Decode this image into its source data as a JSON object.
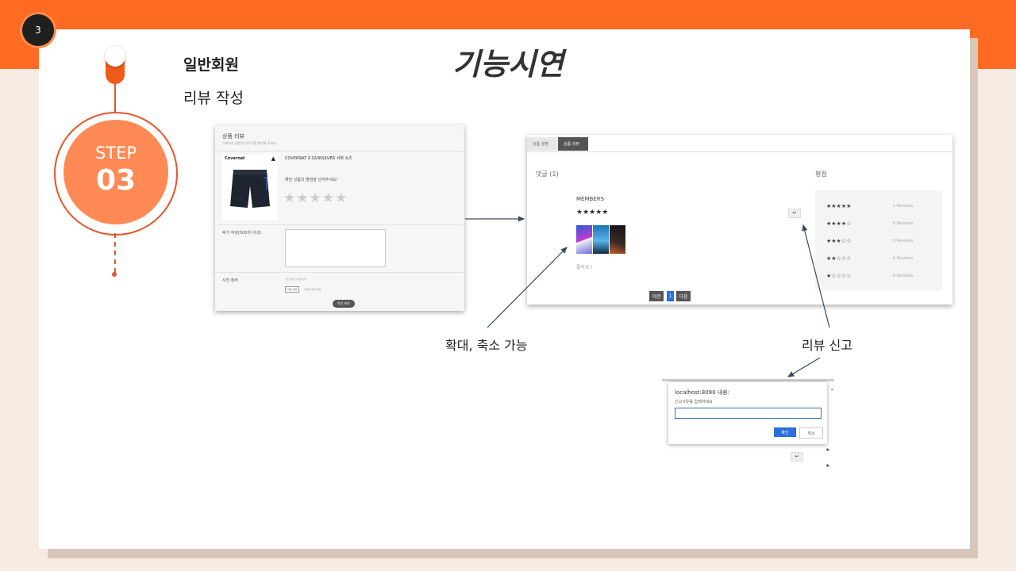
{
  "page_number": "3",
  "title": "기능시연",
  "heading": "일반회원",
  "subheading": "리뷰 작성",
  "step": {
    "label": "STEP",
    "number": "03"
  },
  "review_form": {
    "title": "상품 리뷰",
    "subtitle": "구매하신 상품의 만족도를 평가해 주세요",
    "brand_logo": "Covernat",
    "product_name": "COVERNAT X QUIKSILVER 서퍼 쇼츠",
    "question": "해당 상품의 별점을 남겨주세요!",
    "stars": "★★★★★",
    "content_label": "후기 작성(500자 이내)",
    "photo_label": "사진 첨부",
    "photo_hint": "사진 첨부 가능합니다",
    "file_button": "파일 선택",
    "file_none": "선택된 파일 없음",
    "submit": "작성 완료"
  },
  "review_list": {
    "tabs": [
      "상품 설명",
      "상품 리뷰"
    ],
    "comments_header": "댓글 (1)",
    "rating_header": "평점",
    "member": "MEMBERS",
    "member_stars": "★★★★★",
    "report_icon_text": "↵",
    "like_text": "좋아요 !",
    "pager": {
      "prev": "이전",
      "page": "1",
      "next": "다음"
    },
    "ratings": [
      {
        "stars": "★★★★★",
        "count": "1 Reviews"
      },
      {
        "stars": "★★★★☆",
        "count": "0 Reviews"
      },
      {
        "stars": "★★★☆☆",
        "count": "0 Reviews"
      },
      {
        "stars": "★★☆☆☆",
        "count": "0 Reviews"
      },
      {
        "stars": "★☆☆☆☆",
        "count": "0 Reviews"
      }
    ]
  },
  "dialog": {
    "host": "localhost:8090 내용:",
    "prompt": "신고사유를 입력하세요",
    "ok": "확인",
    "cancel": "취소",
    "close": "×",
    "behind_report_icon_text": "↵"
  },
  "captions": {
    "zoom": "확대, 축소 가능",
    "report": "리뷰 신고"
  },
  "colors": {
    "accent": "#ff6b22",
    "step_disc": "#ff8a55",
    "page_bg": "#f8ebe3"
  }
}
